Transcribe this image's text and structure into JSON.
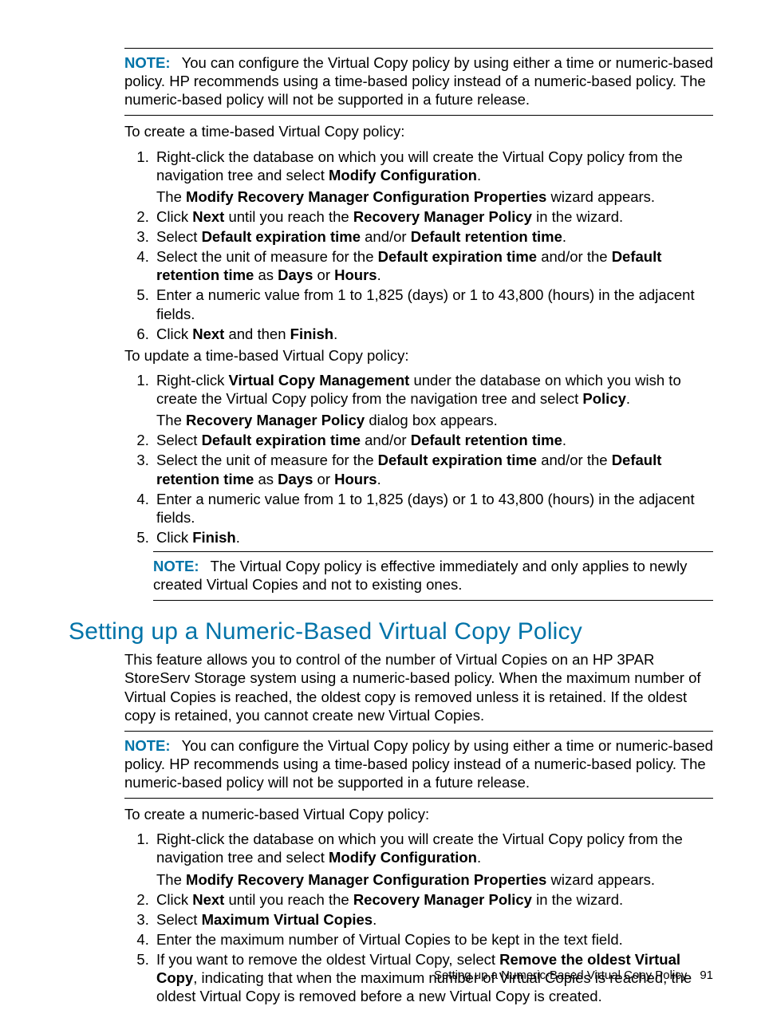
{
  "note1": {
    "label": "NOTE:",
    "text": "You can configure the Virtual Copy policy by using either a time or numeric-based policy. HP recommends using a time-based policy instead of a numeric-based policy. The numeric-based policy will not be supported in a future release."
  },
  "para_create_time": "To create a time-based Virtual Copy policy:",
  "list_create_time": {
    "i1a": "Right-click the database on which you will create the Virtual Copy policy from the navigation tree and select ",
    "i1b": "Modify Configuration",
    "i1c": ".",
    "i1sub_a": "The ",
    "i1sub_b": "Modify Recovery Manager Configuration Properties",
    "i1sub_c": " wizard appears.",
    "i2a": "Click ",
    "i2b": "Next",
    "i2c": " until you reach the ",
    "i2d": "Recovery Manager Policy",
    "i2e": " in the wizard.",
    "i3a": "Select ",
    "i3b": "Default expiration time",
    "i3c": " and/or ",
    "i3d": "Default retention time",
    "i3e": ".",
    "i4a": "Select the unit of measure for the ",
    "i4b": "Default expiration time",
    "i4c": " and/or the ",
    "i4d": "Default retention time",
    "i4e": " as ",
    "i4f": "Days",
    "i4g": " or ",
    "i4h": "Hours",
    "i4i": ".",
    "i5": "Enter a numeric value from 1 to 1,825 (days) or 1 to 43,800 (hours) in the adjacent fields.",
    "i6a": "Click ",
    "i6b": "Next",
    "i6c": " and then ",
    "i6d": "Finish",
    "i6e": "."
  },
  "para_update_time": "To update a time-based Virtual Copy policy:",
  "list_update_time": {
    "i1a": "Right-click ",
    "i1b": "Virtual Copy Management",
    "i1c": " under the database on which you wish to create the Virtual Copy policy from the navigation tree and select ",
    "i1d": "Policy",
    "i1e": ".",
    "i1sub_a": "The ",
    "i1sub_b": "Recovery Manager Policy",
    "i1sub_c": " dialog box appears.",
    "i2a": "Select ",
    "i2b": "Default expiration time",
    "i2c": " and/or ",
    "i2d": "Default retention time",
    "i2e": ".",
    "i3a": "Select the unit of measure for the ",
    "i3b": "Default expiration time",
    "i3c": " and/or the ",
    "i3d": "Default retention time",
    "i3e": " as ",
    "i3f": "Days",
    "i3g": " or ",
    "i3h": "Hours",
    "i3i": ".",
    "i4": "Enter a numeric value from 1 to 1,825 (days) or 1 to 43,800 (hours) in the adjacent fields.",
    "i5a": "Click ",
    "i5b": "Finish",
    "i5c": "."
  },
  "note2": {
    "label": "NOTE:",
    "text": "The Virtual Copy policy is effective immediately and only applies to newly created Virtual Copies and not to existing ones."
  },
  "heading": "Setting up a Numeric-Based Virtual Copy Policy",
  "para_numeric_intro": "This feature allows you to control of the number of Virtual Copies on an HP 3PAR StoreServ Storage system using a numeric-based policy. When the maximum number of Virtual Copies is reached, the oldest copy is removed unless it is retained. If the oldest copy is retained, you cannot create new Virtual Copies.",
  "note3": {
    "label": "NOTE:",
    "text": "You can configure the Virtual Copy policy by using either a time or numeric-based policy. HP recommends using a time-based policy instead of a numeric-based policy. The numeric-based policy will not be supported in a future release."
  },
  "para_create_numeric": "To create a numeric-based Virtual Copy policy:",
  "list_create_numeric": {
    "i1a": "Right-click the database on which you will create the Virtual Copy policy from the navigation tree and select ",
    "i1b": "Modify Configuration",
    "i1c": ".",
    "i1sub_a": "The ",
    "i1sub_b": "Modify Recovery Manager Configuration Properties",
    "i1sub_c": " wizard appears.",
    "i2a": "Click ",
    "i2b": "Next",
    "i2c": " until you reach the ",
    "i2d": "Recovery Manager Policy",
    "i2e": " in the wizard.",
    "i3a": "Select ",
    "i3b": "Maximum Virtual Copies",
    "i3c": ".",
    "i4": "Enter the maximum number of Virtual Copies to be kept in the text field.",
    "i5a": "If you want to remove the oldest Virtual Copy, select ",
    "i5b": "Remove the oldest Virtual Copy",
    "i5c": ", indicating that when the maximum number of Virtual Copies is reached, the oldest Virtual Copy is removed before a new Virtual Copy is created."
  },
  "footer_text": "Setting up a Numeric-Based Virtual Copy Policy",
  "page_number": "91"
}
